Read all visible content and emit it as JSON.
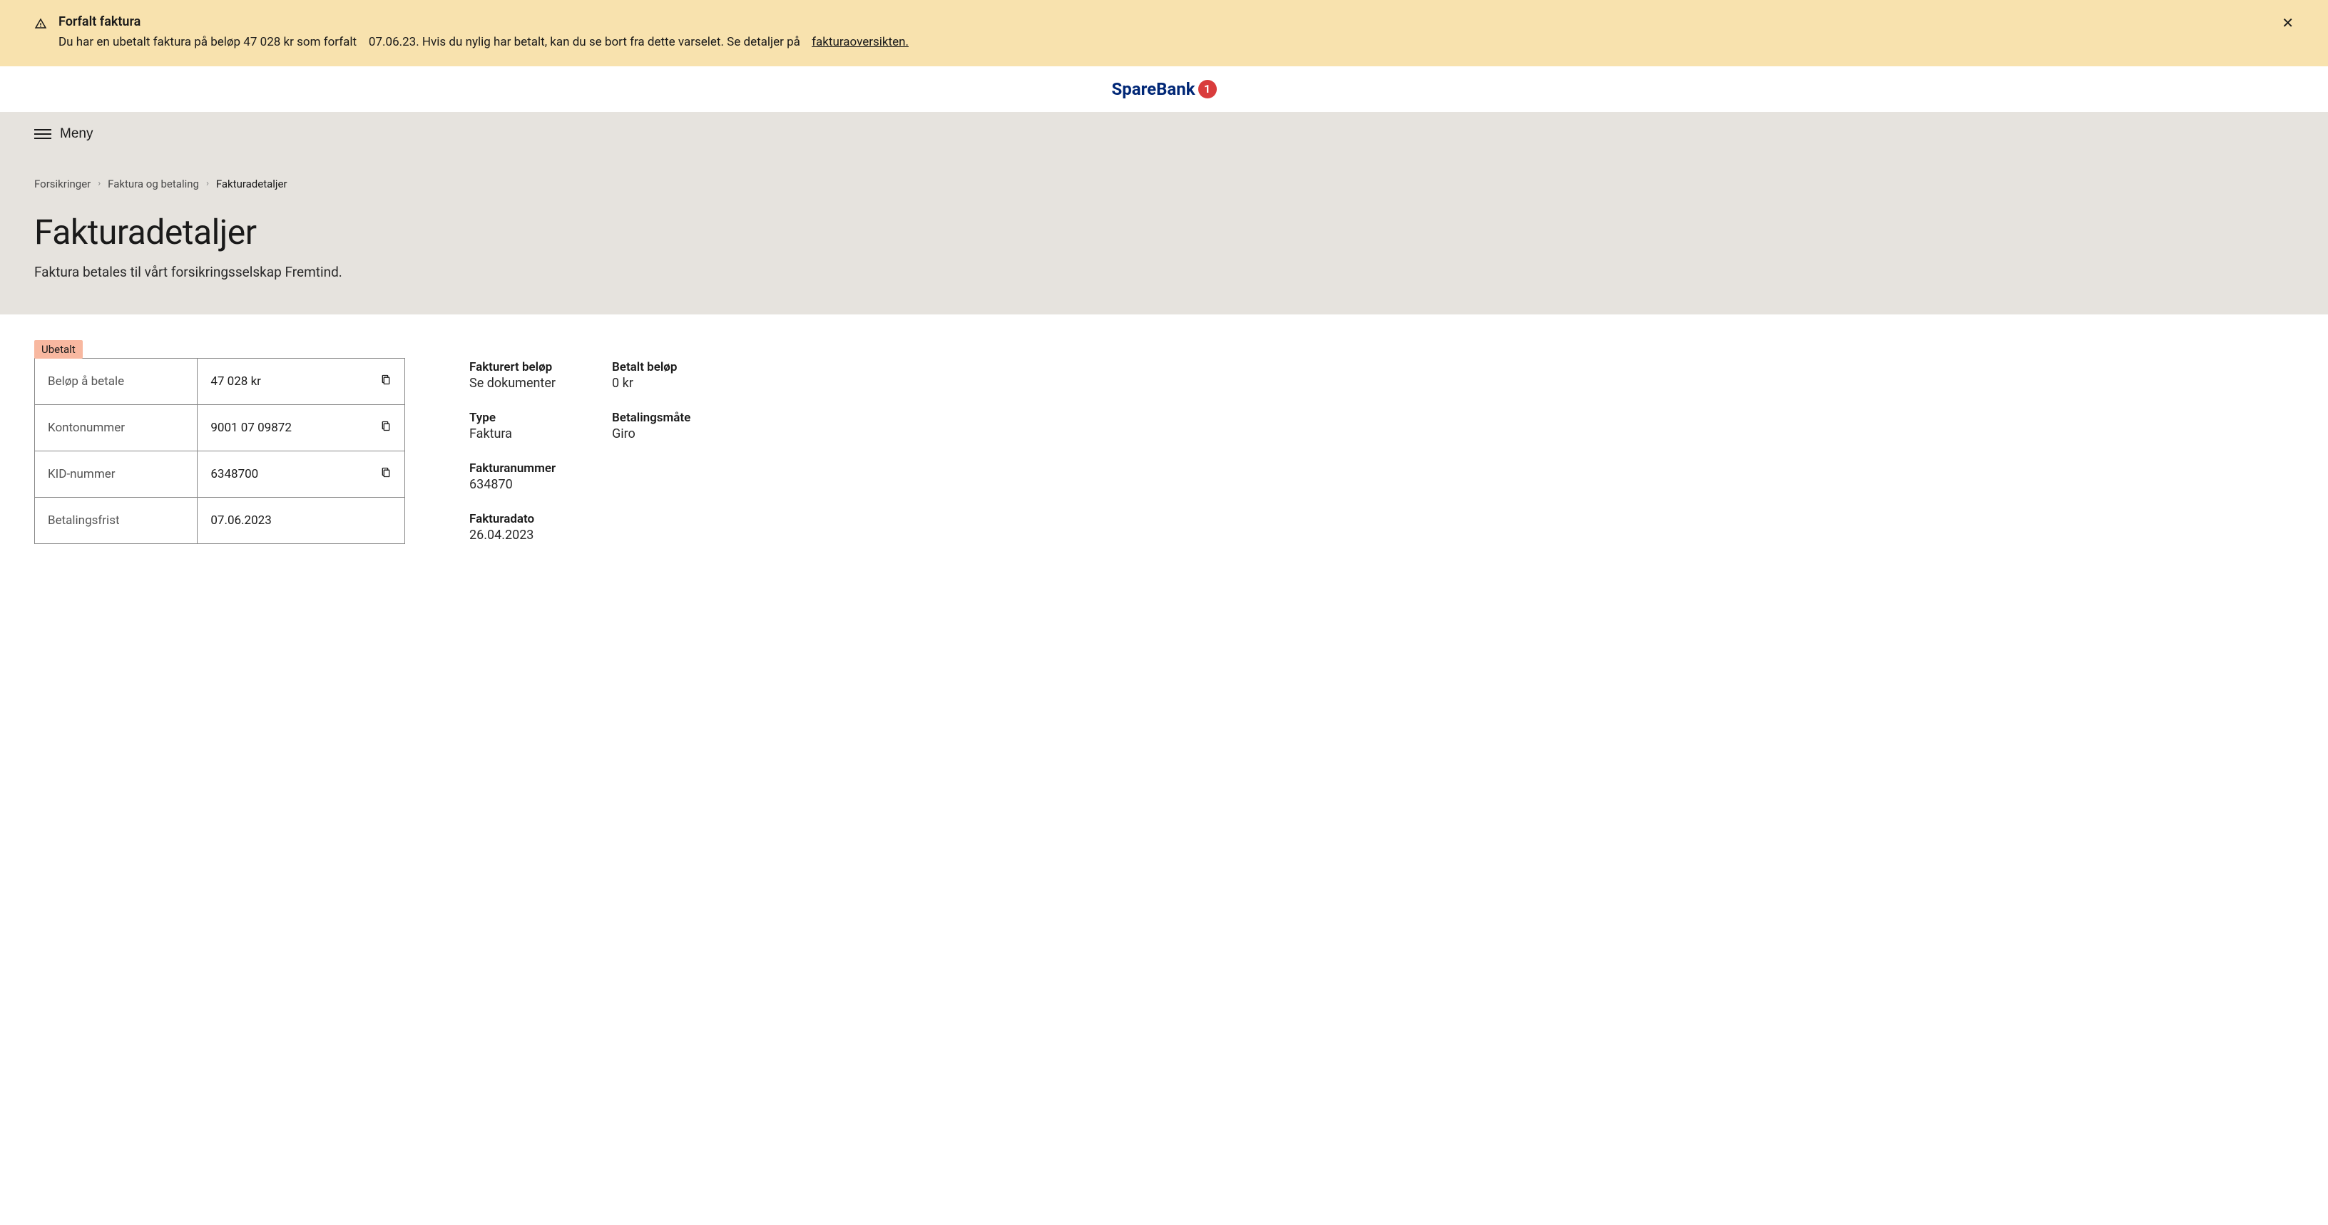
{
  "alert": {
    "title": "Forfalt faktura",
    "text_part1": "Du har en ubetalt faktura på beløp 47 028 kr som forfalt",
    "text_part2": "07.06.23. Hvis du nylig har betalt, kan du se bort fra dette varselet. Se detaljer på",
    "link": "fakturaoversikten."
  },
  "logo": {
    "text": "SpareBank",
    "number": "1"
  },
  "menu": {
    "label": "Meny"
  },
  "breadcrumb": {
    "items": [
      {
        "label": "Forsikringer"
      },
      {
        "label": "Faktura og betaling"
      }
    ],
    "current": "Fakturadetaljer"
  },
  "page": {
    "title": "Fakturadetaljer",
    "subtitle": "Faktura betales til vårt forsikringsselskap Fremtind."
  },
  "status": {
    "label": "Ubetalt"
  },
  "table": {
    "rows": [
      {
        "label": "Beløp å betale",
        "value": "47 028 kr",
        "copyable": true
      },
      {
        "label": "Kontonummer",
        "value": "9001 07 09872",
        "copyable": true
      },
      {
        "label": "KID-nummer",
        "value": "6348700",
        "copyable": true
      },
      {
        "label": "Betalingsfrist",
        "value": "07.06.2023",
        "copyable": false
      }
    ]
  },
  "info": {
    "blocks": [
      {
        "label": "Fakturert beløp",
        "value": "Se dokumenter"
      },
      {
        "label": "Betalt beløp",
        "value": "0 kr"
      },
      {
        "label": "Type",
        "value": "Faktura"
      },
      {
        "label": "Betalingsmåte",
        "value": "Giro"
      },
      {
        "label": "Fakturanummer",
        "value": "634870"
      },
      {
        "label": "Fakturadato",
        "value": "26.04.2023"
      }
    ]
  }
}
